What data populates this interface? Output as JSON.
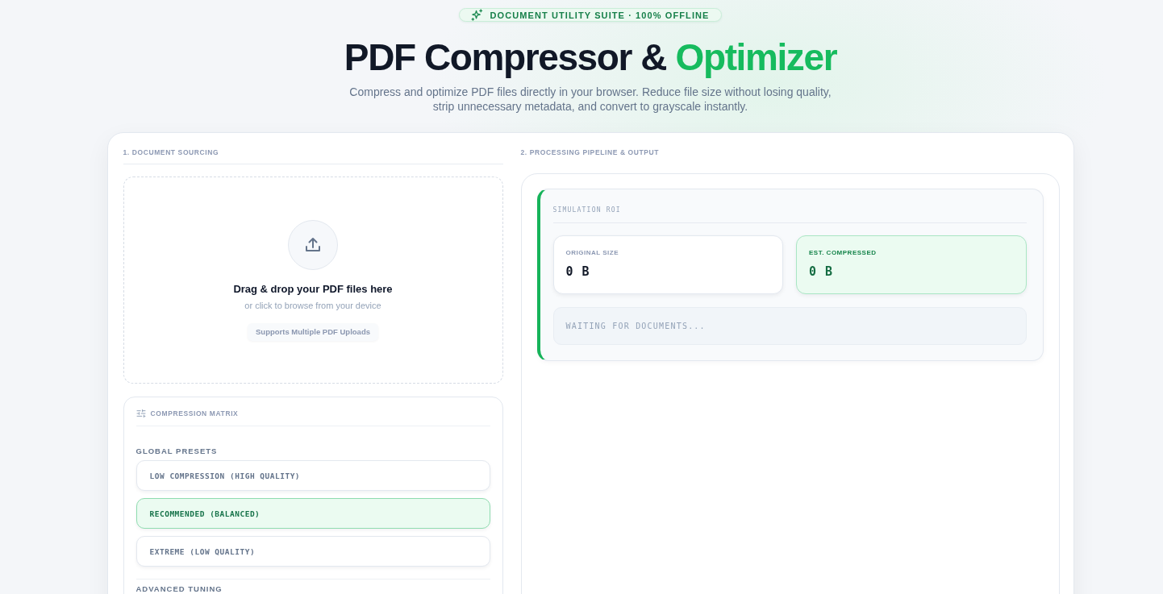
{
  "badge": {
    "text": "DOCUMENT UTILITY SUITE · 100% OFFLINE"
  },
  "header": {
    "title": [
      {
        "text": "PDF Compressor &",
        "accent": false
      },
      {
        "text": "Optimizer",
        "accent": true
      }
    ],
    "subtitle": "Compress and optimize PDF files directly in your browser. Reduce file size without losing quality, strip unnecessary metadata, and convert to grayscale instantly."
  },
  "sourcing": {
    "heading": "1. DOCUMENT SOURCING",
    "dropzone": {
      "title": "Drag & drop your PDF files here",
      "hint": "or click to browse from your device",
      "chip": "Supports Multiple PDF Uploads"
    }
  },
  "compression": {
    "title": "COMPRESSION MATRIX",
    "presets_label": "GLOBAL PRESETS",
    "presets": [
      {
        "label": "LOW COMPRESSION (HIGH QUALITY)",
        "selected": false
      },
      {
        "label": "RECOMMENDED (BALANCED)",
        "selected": true
      },
      {
        "label": "EXTREME (LOW QUALITY)",
        "selected": false
      }
    ],
    "advanced_label": "ADVANCED TUNING"
  },
  "output": {
    "heading": "2. PROCESSING PIPELINE & OUTPUT",
    "roi": {
      "title": "SIMULATION ROI",
      "stats": [
        {
          "label": "ORIGINAL SIZE",
          "value": "0 B",
          "kind": "original"
        },
        {
          "label": "EST. COMPRESSED",
          "value": "0 B",
          "kind": "compressed"
        }
      ],
      "status": "WAITING FOR DOCUMENTS..."
    }
  }
}
